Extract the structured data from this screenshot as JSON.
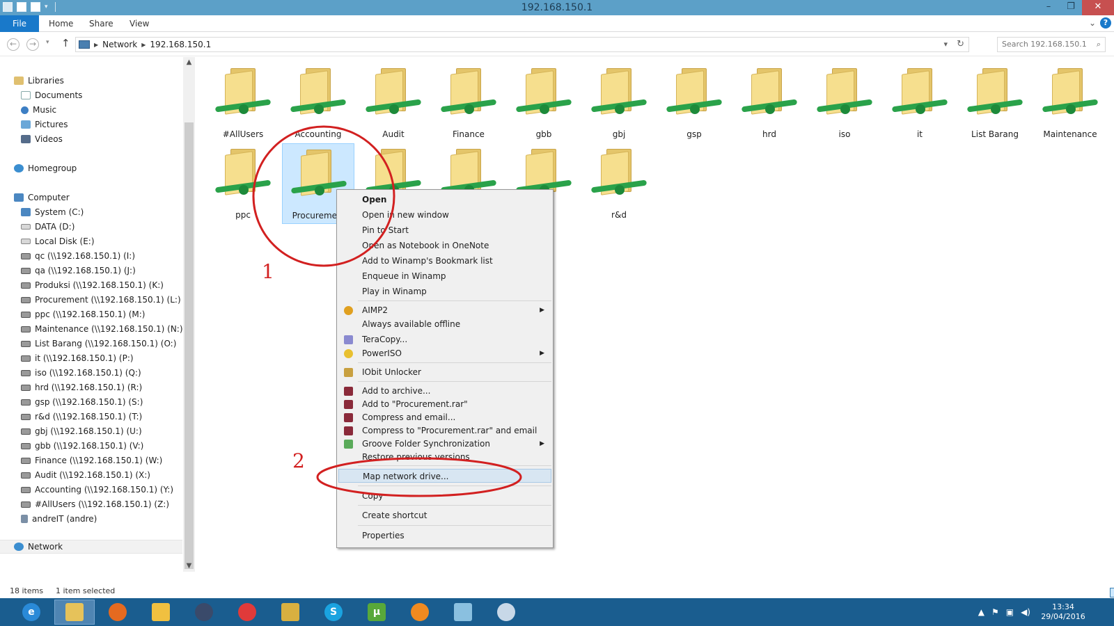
{
  "window": {
    "title": "192.168.150.1",
    "minimize": "–",
    "restore": "❐",
    "close": "✕"
  },
  "ribbon": {
    "tabs": [
      "File",
      "Home",
      "Share",
      "View"
    ],
    "help": "?"
  },
  "address": {
    "crumbs": [
      "Network",
      "192.168.150.1"
    ],
    "search_placeholder": "Search 192.168.150.1"
  },
  "sidebar": {
    "libraries": {
      "label": "Libraries",
      "items": [
        "Documents",
        "Music",
        "Pictures",
        "Videos"
      ]
    },
    "homegroup": "Homegroup",
    "computer": {
      "label": "Computer",
      "drives": [
        "System (C:)",
        "DATA (D:)",
        "Local Disk (E:)",
        "qc (\\\\192.168.150.1) (I:)",
        "qa (\\\\192.168.150.1) (J:)",
        "Produksi (\\\\192.168.150.1) (K:)",
        "Procurement (\\\\192.168.150.1) (L:)",
        "ppc (\\\\192.168.150.1) (M:)",
        "Maintenance (\\\\192.168.150.1) (N:)",
        "List Barang (\\\\192.168.150.1) (O:)",
        "it (\\\\192.168.150.1) (P:)",
        "iso (\\\\192.168.150.1) (Q:)",
        "hrd (\\\\192.168.150.1) (R:)",
        "gsp (\\\\192.168.150.1) (S:)",
        "r&d (\\\\192.168.150.1) (T:)",
        "gbj (\\\\192.168.150.1) (U:)",
        "gbb (\\\\192.168.150.1) (V:)",
        "Finance (\\\\192.168.150.1) (W:)",
        "Audit (\\\\192.168.150.1) (X:)",
        "Accounting (\\\\192.168.150.1) (Y:)",
        "#AllUsers (\\\\192.168.150.1) (Z:)",
        "andreIT (andre)"
      ]
    },
    "network": "Network"
  },
  "folders": [
    "#AllUsers",
    "Accounting",
    "Audit",
    "Finance",
    "gbb",
    "gbj",
    "gsp",
    "hrd",
    "iso",
    "it",
    "List Barang",
    "Maintenance",
    "ppc",
    "Procurement",
    "",
    "",
    "",
    "r&d"
  ],
  "selected_folder": "Procurement",
  "context_menu": {
    "items": [
      {
        "label": "Open",
        "bold": true
      },
      {
        "label": "Open in new window"
      },
      {
        "label": "Pin to Start"
      },
      {
        "label": "Open as Notebook in OneNote"
      },
      {
        "label": "Add to Winamp's Bookmark list"
      },
      {
        "label": "Enqueue in Winamp"
      },
      {
        "label": "Play in Winamp"
      },
      {
        "label": "AIMP2",
        "submenu": true
      },
      {
        "label": "Always available offline"
      },
      {
        "label": "TeraCopy..."
      },
      {
        "label": "PowerISO",
        "submenu": true
      },
      {
        "label": "IObit Unlocker"
      },
      {
        "label": "Add to archive..."
      },
      {
        "label": "Add to \"Procurement.rar\""
      },
      {
        "label": "Compress and email..."
      },
      {
        "label": "Compress to \"Procurement.rar\" and email"
      },
      {
        "label": "Groove Folder Synchronization",
        "submenu": true
      },
      {
        "label": "Restore previous versions"
      },
      {
        "label": "Map network drive...",
        "highlighted": true
      },
      {
        "label": "Copy"
      },
      {
        "label": "Create shortcut"
      },
      {
        "label": "Properties"
      }
    ],
    "submenu_arrow": "▶"
  },
  "annotations": {
    "step1": "1",
    "step2": "2",
    "color": "#d22020"
  },
  "status": {
    "item_count": "18 items",
    "selection": "1 item selected"
  },
  "taskbar": {
    "apps": [
      "internet-explorer",
      "file-explorer",
      "firefox",
      "outlook",
      "winamp",
      "gom-player",
      "teracopy",
      "skype",
      "utorrent",
      "nero",
      "notepad",
      "paint"
    ],
    "time": "13:34",
    "date": "29/04/2016"
  },
  "colors": {
    "titlebar": "#5ca0c8",
    "file_tab": "#1979ca",
    "taskbar": "#1a5d8f",
    "selection": "#cce8ff"
  }
}
